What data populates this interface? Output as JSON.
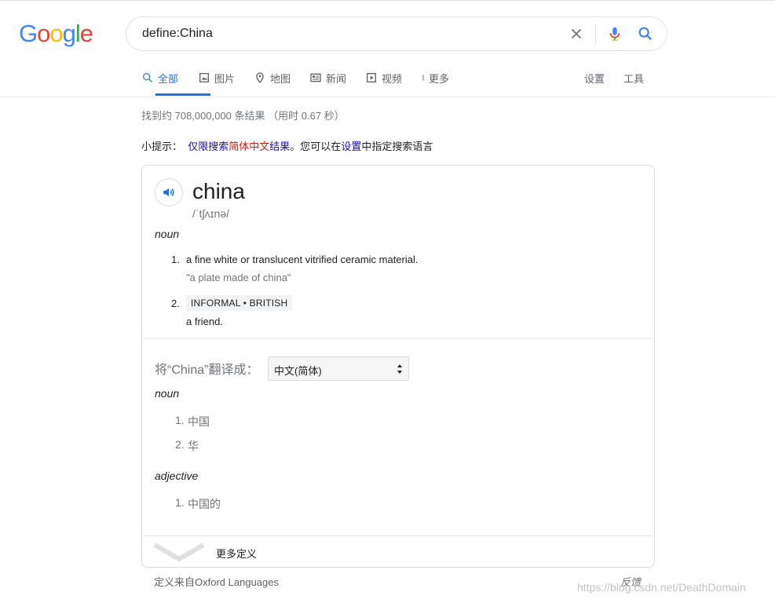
{
  "logo": {
    "letters": [
      "G",
      "o",
      "o",
      "g",
      "l",
      "e"
    ],
    "colors": [
      "#4285f4",
      "#ea4335",
      "#fbbc05",
      "#4285f4",
      "#34a853",
      "#ea4335"
    ]
  },
  "search": {
    "query": "define:China"
  },
  "tabs": [
    {
      "label": "全部",
      "icon": "search-icon"
    },
    {
      "label": "图片",
      "icon": "image-icon"
    },
    {
      "label": "地图",
      "icon": "map-pin-icon"
    },
    {
      "label": "新闻",
      "icon": "news-icon"
    },
    {
      "label": "视频",
      "icon": "video-icon"
    },
    {
      "label": "更多",
      "icon": "more-vert-icon"
    }
  ],
  "tools": {
    "settings": "设置",
    "tools": "工具"
  },
  "stats": "找到约 708,000,000 条结果 （用时 0.67 秒）",
  "tip": {
    "prefix": "小提示：",
    "part1": "仅限搜索",
    "part2": "简体中文",
    "part3": "结果",
    "part4": "。您可以在",
    "part5": "设置",
    "part6": "中指定搜索语言"
  },
  "dictionary": {
    "word": "china",
    "phonetic": "/ˈtʃʌɪnə/",
    "pos": "noun",
    "senses": [
      {
        "num": "1.",
        "definition": "a fine white or translucent vitrified ceramic material.",
        "example": "\"a plate made of china\""
      },
      {
        "num": "2.",
        "tag": "INFORMAL • BRITISH",
        "definition": "a friend."
      }
    ]
  },
  "translation": {
    "label": "将“China”翻译成：",
    "language": "中文(简体)",
    "groups": [
      {
        "pos": "noun",
        "items": [
          {
            "num": "1.",
            "text": "中国"
          },
          {
            "num": "2.",
            "text": "华"
          }
        ]
      },
      {
        "pos": "adjective",
        "items": [
          {
            "num": "1.",
            "text": "中国的"
          }
        ]
      }
    ]
  },
  "more_definitions": "更多定义",
  "footer": {
    "source": "定义来自Oxford Languages",
    "feedback": "反馈"
  },
  "watermark": "https://blog.csdn.net/DeathDomain"
}
